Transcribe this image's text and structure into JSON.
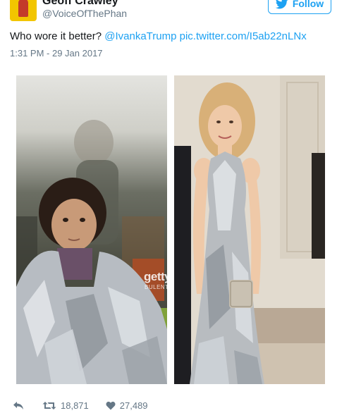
{
  "tweet": {
    "author_name": "Geoff Crawley",
    "author_handle": "@VoiceOfThePhan",
    "follow_label": "Follow",
    "text_plain": "Who wore it better? ",
    "mention": "@IvankaTrump",
    "link": "pic.twitter.com/I5ab22nLNx",
    "timestamp": "1:31 PM - 29 Jan 2017",
    "retweets": "18,871",
    "likes": "27,489"
  },
  "photos": {
    "watermark": "getty",
    "watermark_sub": "BULENT"
  },
  "colors": {
    "accent": "#1da1f2",
    "muted": "#657786",
    "text": "#14171a"
  },
  "icons": {
    "follow": "twitter-bird-icon",
    "reply": "reply-icon",
    "retweet": "retweet-icon",
    "like": "heart-icon"
  }
}
